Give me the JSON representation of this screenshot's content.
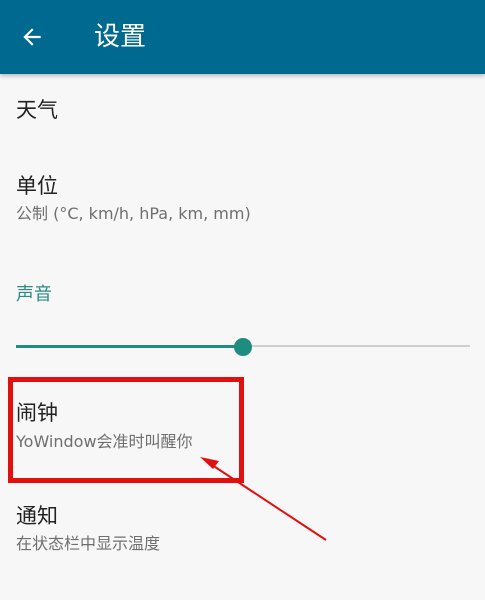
{
  "app_bar": {
    "title": "设置",
    "background": "#00698f",
    "back_icon": "arrow-left-icon"
  },
  "settings": {
    "weather": {
      "title": "天气"
    },
    "units": {
      "title": "单位",
      "summary": "公制 (°C, km/h, hPa, km, mm)"
    },
    "sound": {
      "title": "声音",
      "level": 0.5,
      "accent": "#1e8c7e"
    },
    "alarm": {
      "title": "闹钟",
      "summary": "YoWindow会准时叫醒你"
    },
    "notification": {
      "title": "通知",
      "summary": "在状态栏中显示温度"
    }
  },
  "annotation": {
    "color": "#e01010",
    "shape": "rectangle-with-arrow"
  }
}
